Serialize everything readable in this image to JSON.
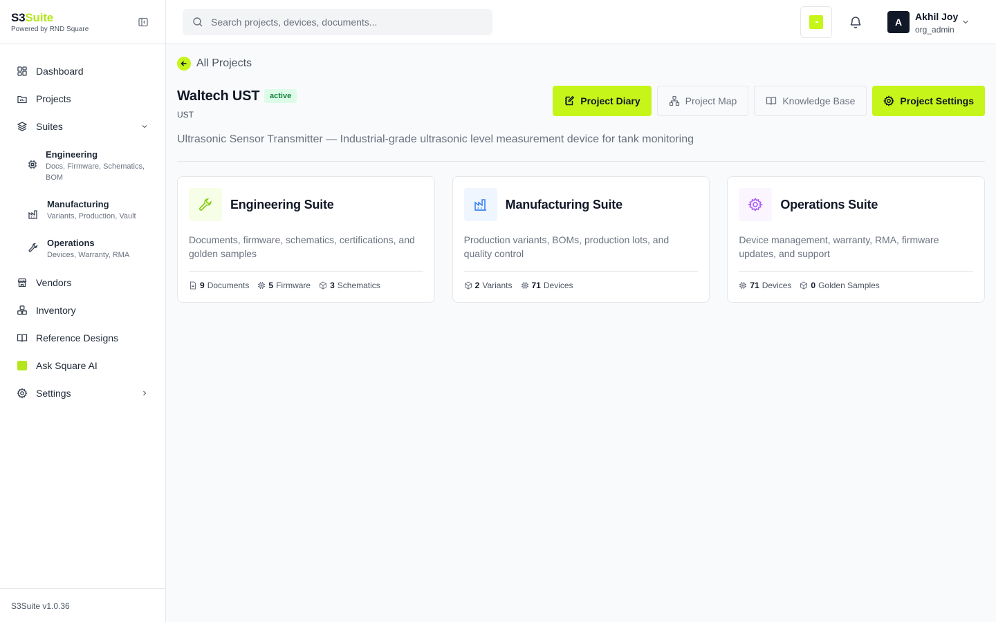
{
  "brand": {
    "name_a": "S3",
    "name_b": "Suite",
    "tagline": "Powered by RND Square",
    "version": "S3Suite v1.0.36"
  },
  "sidebar": {
    "items": [
      {
        "label": "Dashboard"
      },
      {
        "label": "Projects"
      },
      {
        "label": "Suites"
      },
      {
        "label": "Vendors"
      },
      {
        "label": "Inventory"
      },
      {
        "label": "Reference Designs"
      },
      {
        "label": "Ask Square AI"
      },
      {
        "label": "Settings"
      }
    ],
    "suites": [
      {
        "title": "Engineering",
        "desc": "Docs, Firmware, Schematics, BOM"
      },
      {
        "title": "Manufacturing",
        "desc": "Variants, Production, Vault"
      },
      {
        "title": "Operations",
        "desc": "Devices, Warranty, RMA"
      }
    ]
  },
  "search": {
    "placeholder": "Search projects, devices, documents...",
    "value": ""
  },
  "user": {
    "initial": "A",
    "name": "Akhil Joy",
    "role": "org_admin"
  },
  "page": {
    "back_label": "All Projects",
    "title": "Waltech UST",
    "status": "active",
    "code": "UST",
    "description": "Ultrasonic Sensor Transmitter — Industrial-grade ultrasonic level measurement device for tank monitoring",
    "actions": {
      "diary": "Project Diary",
      "map": "Project Map",
      "kb": "Knowledge Base",
      "settings": "Project Settings"
    }
  },
  "cards": [
    {
      "title": "Engineering Suite",
      "desc": "Documents, firmware, schematics, certifications, and golden samples",
      "stats": [
        {
          "n": "9",
          "label": "Documents"
        },
        {
          "n": "5",
          "label": "Firmware"
        },
        {
          "n": "3",
          "label": "Schematics"
        }
      ]
    },
    {
      "title": "Manufacturing Suite",
      "desc": "Production variants, BOMs, production lots, and quality control",
      "stats": [
        {
          "n": "2",
          "label": "Variants"
        },
        {
          "n": "71",
          "label": "Devices"
        }
      ]
    },
    {
      "title": "Operations Suite",
      "desc": "Device management, warranty, RMA, firmware updates, and support",
      "stats": [
        {
          "n": "71",
          "label": "Devices"
        },
        {
          "n": "0",
          "label": "Golden Samples"
        }
      ]
    }
  ],
  "colors": {
    "accent": "#c6f51a",
    "eng_bg": "#f7fee7",
    "eng_fg": "#84cc16",
    "mfg_bg": "#eff6ff",
    "mfg_fg": "#3b82f6",
    "ops_bg": "#faf5ff",
    "ops_fg": "#a855f7"
  }
}
